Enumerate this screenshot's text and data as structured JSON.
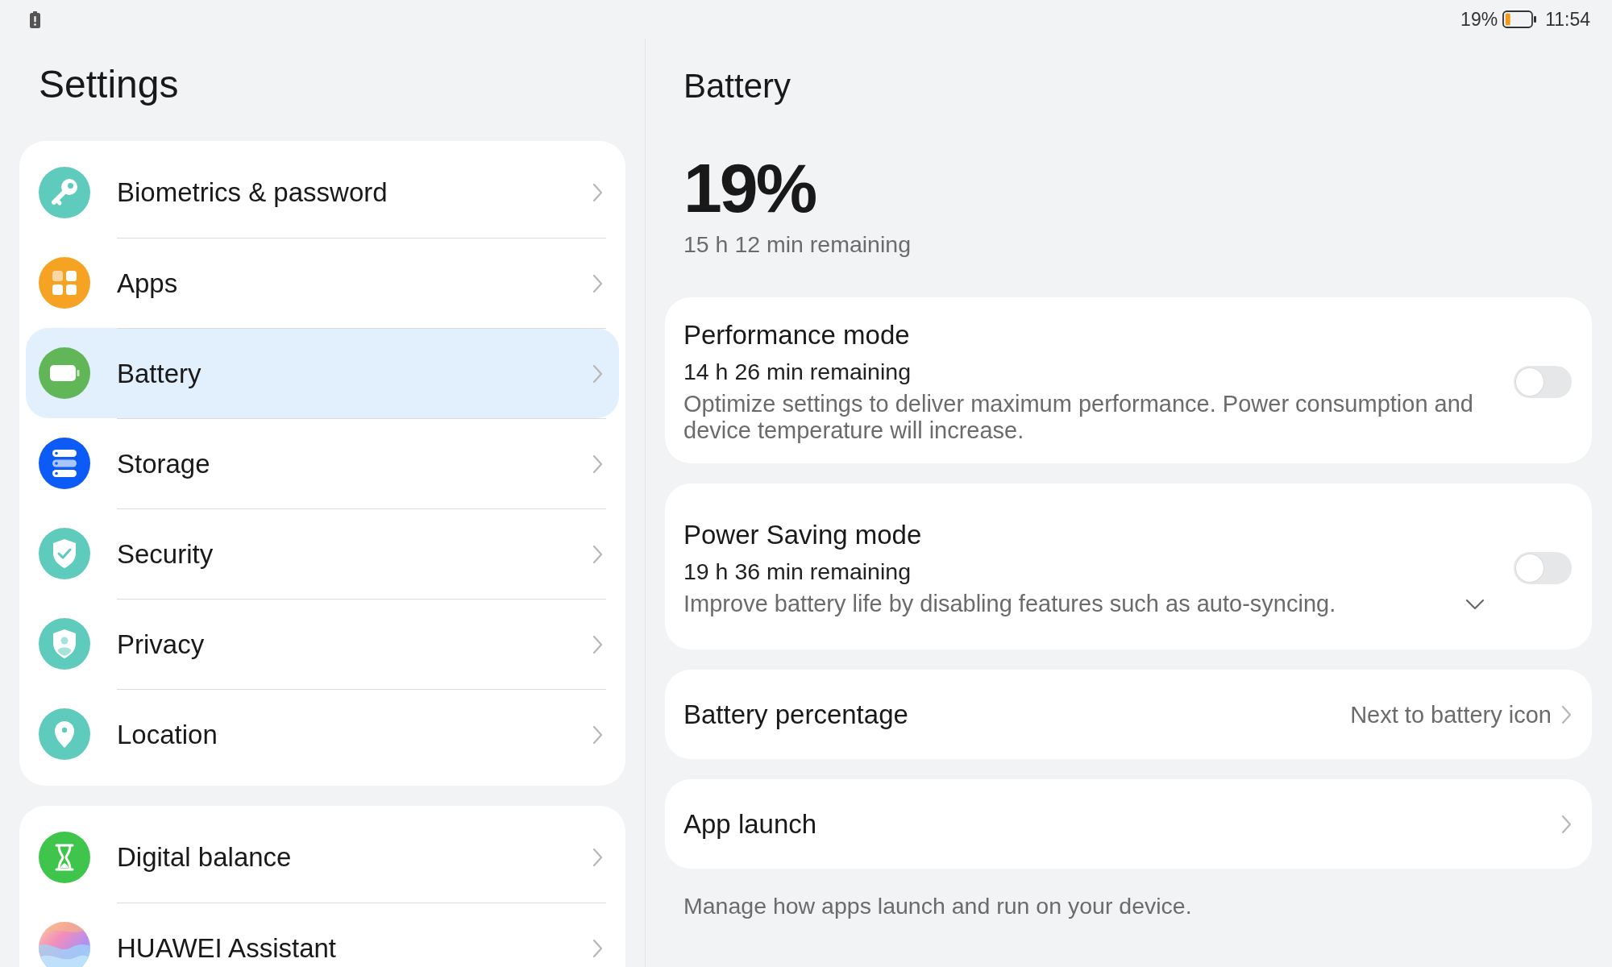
{
  "status_bar": {
    "battery_percent": "19%",
    "time": "11:54"
  },
  "sidebar": {
    "title": "Settings",
    "groups": [
      {
        "items": [
          {
            "label": "Biometrics & password",
            "selected": false
          },
          {
            "label": "Apps",
            "selected": false
          },
          {
            "label": "Battery",
            "selected": true
          },
          {
            "label": "Storage",
            "selected": false
          },
          {
            "label": "Security",
            "selected": false
          },
          {
            "label": "Privacy",
            "selected": false
          },
          {
            "label": "Location",
            "selected": false
          }
        ]
      },
      {
        "items": [
          {
            "label": "Digital balance",
            "selected": false
          },
          {
            "label": "HUAWEI Assistant",
            "selected": false
          }
        ]
      }
    ]
  },
  "panel": {
    "title": "Battery",
    "charge": "19%",
    "remaining": "15 h 12 min remaining",
    "items": [
      {
        "kind": "toggle",
        "title": "Performance mode",
        "subtitle": "14 h 26 min remaining",
        "description": "Optimize settings to deliver maximum performance. Power consumption and device temperature will increase.",
        "on": false
      },
      {
        "kind": "toggle",
        "title": "Power Saving mode",
        "subtitle": "19 h 36 min remaining",
        "description": "Improve battery life by disabling features such as auto-syncing.",
        "on": false,
        "expanded": false
      },
      {
        "kind": "link",
        "title": "Battery percentage",
        "value": "Next to battery icon"
      },
      {
        "kind": "link",
        "title": "App launch"
      },
      {
        "kind": "note",
        "text": "Manage how apps launch and run on your device."
      }
    ]
  }
}
